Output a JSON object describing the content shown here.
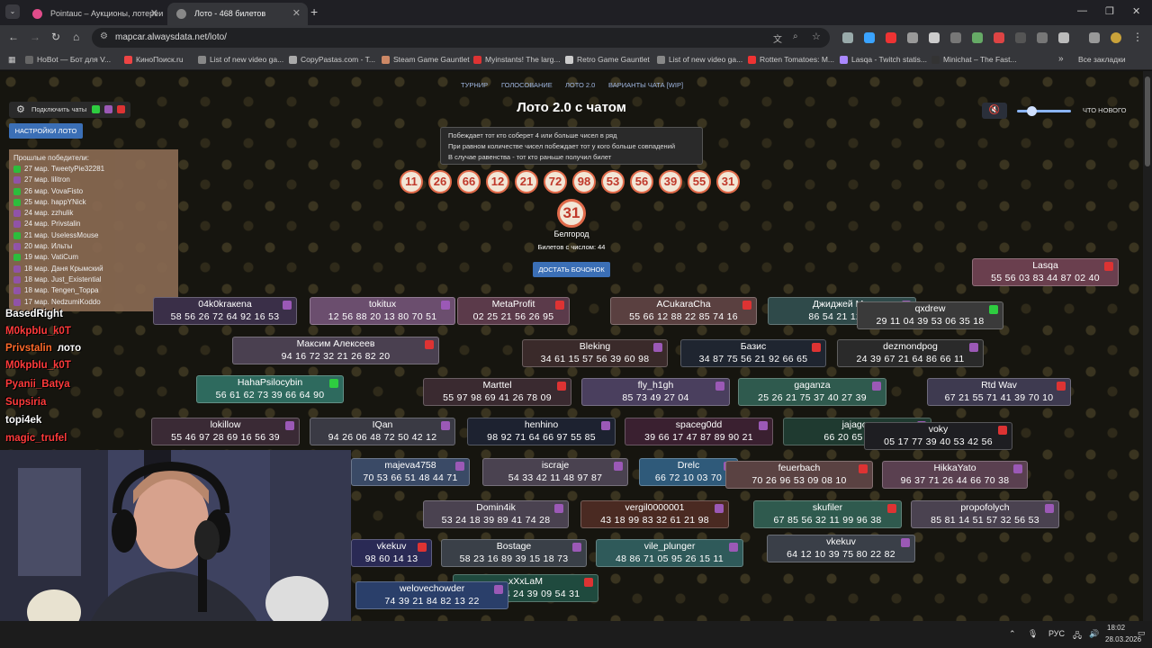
{
  "tabs": [
    {
      "label": "Pointauc – Аукционы, лотереи",
      "active": false,
      "color": "#e04c8a"
    },
    {
      "label": "Лото - 468 билетов",
      "active": true,
      "color": "#888"
    }
  ],
  "url": "mapcar.alwaysdata.net/loto/",
  "bookmarks": [
    {
      "label": "HoBot — Бот для V...",
      "color": "#666"
    },
    {
      "label": "КиноПоиск.ru",
      "color": "#e44"
    },
    {
      "label": "List of new video ga...",
      "color": "#888"
    },
    {
      "label": "CopyPastas.com - T...",
      "color": "#aaa"
    },
    {
      "label": "Steam Game Gauntlet",
      "color": "#c86"
    },
    {
      "label": "Myinstants! The larg...",
      "color": "#d33"
    },
    {
      "label": "Retro Game Gauntlet",
      "color": "#ccc"
    },
    {
      "label": "List of new video ga...",
      "color": "#888"
    },
    {
      "label": "Rotten Tomatoes: M...",
      "color": "#e33"
    },
    {
      "label": "Lasqa - Twitch statis...",
      "color": "#a8f"
    },
    {
      "label": "Minichat – The Fast...",
      "color": "#333"
    }
  ],
  "bookmarks_all": "Все закладки",
  "nav": [
    "ТУРНИР",
    "ГОЛОСОВАНИЕ",
    "ЛОТО 2.0",
    "ВАРИАНТЫ ЧАТА [WIP]"
  ],
  "title": "Лото 2.0 с чатом",
  "rules": [
    "Побеждает тот кто соберет 4 или больше чисел в ряд",
    "При равном количестве чисел побеждает тот у кого больше совпадений",
    "В случае равенства - тот кто раньше получил билет"
  ],
  "drawn": [
    "11",
    "26",
    "66",
    "12",
    "21",
    "72",
    "98",
    "53",
    "56",
    "39",
    "55",
    "31"
  ],
  "current": "31",
  "city": "Белгород",
  "tickets_count": "Билетов с числом: 44",
  "draw_button": "ДОСТАТЬ БОЧОНОК",
  "whats_new": "ЧТО НОВОГО",
  "connect_label": "Подключить чаты",
  "settings_label": "НАСТРОЙКИ ЛОТО",
  "winners_title": "Прошлые победители:",
  "winners": [
    {
      "text": "27 мар. TweetyPie32281",
      "c": "#2ecc40"
    },
    {
      "text": "27 мар. lilitron",
      "c": "#9b59b6"
    },
    {
      "text": "26 мар. VovaFisto",
      "c": "#2ecc40"
    },
    {
      "text": "25 мар. happYNick",
      "c": "#2ecc40"
    },
    {
      "text": "24 мар. zzhulik",
      "c": "#9b59b6"
    },
    {
      "text": "24 мар. Privstalin",
      "c": "#9b59b6"
    },
    {
      "text": "21 мар. UselessMouse",
      "c": "#2ecc40"
    },
    {
      "text": "20 мар. Ильты",
      "c": "#9b59b6"
    },
    {
      "text": "19 мар. VatiCum",
      "c": "#2ecc40"
    },
    {
      "text": "18 мар. Даня Крымский",
      "c": "#9b59b6"
    },
    {
      "text": "18 мар. Just_Existential",
      "c": "#9b59b6"
    },
    {
      "text": "18 мар. Tengen_Toppa",
      "c": "#9b59b6"
    },
    {
      "text": "17 мар. NedzumiKoddo",
      "c": "#9b59b6"
    }
  ],
  "tickets": [
    {
      "name": "Lasqa",
      "nums": "55 56 03 83 44 87 02 40",
      "bg": "#6a3f4e",
      "ic": "#d33"
    },
    {
      "name": "04k0kraкena",
      "nums": "58 56 26 72 64 92 16 53",
      "bg": "#3a2f48",
      "ic": "#9b59b6"
    },
    {
      "name": "tokitux",
      "nums": "12 56 88 20 13 80 70 51",
      "bg": "#6b4e6e",
      "ic": "#9b59b6"
    },
    {
      "name": "MetaProfit",
      "nums": "02 25 21 56 26 95",
      "bg": "#5b3a4a",
      "ic": "#d33"
    },
    {
      "name": "ACukaraCha",
      "nums": "55 66 12 88 22 85 74 16",
      "bg": "#5a4040",
      "ic": "#d33"
    },
    {
      "name": "Джиджей М...",
      "nums": "86 54 21 12 73",
      "bg": "#2f4a4a",
      "ic": "#9b59b6"
    },
    {
      "name": "qxdrew",
      "nums": "29 11 04 39 53 06 35 18",
      "bg": "#3a3a3a",
      "ic": "#2ecc40"
    },
    {
      "name": "Максим Алексеев",
      "nums": "94 16 72 32 21 26 82 20",
      "bg": "#4a4050",
      "ic": "#d33"
    },
    {
      "name": "Bleking",
      "nums": "34 61 15 57 56 39 60 98",
      "bg": "#3a2a2a",
      "ic": "#9b59b6"
    },
    {
      "name": "Базис",
      "nums": "34 87 75 56 21 92 66 65",
      "bg": "#1f2530",
      "ic": "#d33"
    },
    {
      "name": "dezmondpog",
      "nums": "24 39 67 21 64 86 66 11",
      "bg": "#2a2a2a",
      "ic": "#9b59b6"
    },
    {
      "name": "HahaPsilocybin",
      "nums": "56 61 62 73 39 66 64 90",
      "bg": "#2e6a5e",
      "ic": "#2ecc40"
    },
    {
      "name": "Marttel",
      "nums": "55 97 98 69 41 26 78 09",
      "bg": "#3a2a30",
      "ic": "#d33"
    },
    {
      "name": "fly_h1gh",
      "nums": "85 73 49 27 04",
      "bg": "#4a3f5e",
      "ic": "#9b59b6"
    },
    {
      "name": "gaganza",
      "nums": "25 26 21 75 37 40 27 39",
      "bg": "#2f5a4e",
      "ic": "#9b59b6"
    },
    {
      "name": "Rtd Wav",
      "nums": "67 21 55 71 41 39 70 10",
      "bg": "#3e3a50",
      "ic": "#d33"
    },
    {
      "name": "lokillow",
      "nums": "55 46 97 28 69 16 56 39",
      "bg": "#3a2a35",
      "ic": "#9b59b6"
    },
    {
      "name": "IQan",
      "nums": "94 26 06 48 72 50 42 12",
      "bg": "#3a3a44",
      "ic": "#9b59b6"
    },
    {
      "name": "henhino",
      "nums": "98 92 71 64 66 97 55 85",
      "bg": "#1d2230",
      "ic": "#9b59b6"
    },
    {
      "name": "spaceg0dd",
      "nums": "39 66 17 47 87 89 90 21",
      "bg": "#3a2030",
      "ic": "#9b59b6"
    },
    {
      "name": "jajagoo",
      "nums": "66 20 65 14 53",
      "bg": "#1f3a30",
      "ic": "#9b59b6"
    },
    {
      "name": "voky",
      "nums": "05 17 77 39 40 53 42 56",
      "bg": "#1e1e22",
      "ic": "#d33"
    },
    {
      "name": "majeva4758",
      "nums": "70 53 66 51 48 44 71",
      "bg": "#3a4a66",
      "ic": "#9b59b6"
    },
    {
      "name": "iscraje",
      "nums": "54 33 42 11 48 97 87",
      "bg": "#4a4250",
      "ic": "#9b59b6"
    },
    {
      "name": "Drelc",
      "nums": "66 72 10 03 70",
      "bg": "#2f5a7a",
      "ic": "#9b59b6"
    },
    {
      "name": "feuerbach",
      "nums": "70 26 96 53 09 08 10",
      "bg": "#5a4242",
      "ic": "#d33"
    },
    {
      "name": "HikkaYato",
      "nums": "96 37 71 26 44 66 70 38",
      "bg": "#5a4050",
      "ic": "#9b59b6"
    },
    {
      "name": "Domin4ik",
      "nums": "53 24 18 39 89 41 74 28",
      "bg": "#4a4250",
      "ic": "#9b59b6"
    },
    {
      "name": "vergil0000001",
      "nums": "43 18 99 83 32 61 21 98",
      "bg": "#4a2a22",
      "ic": "#9b59b6"
    },
    {
      "name": "skufiler",
      "nums": "67 85 56 32 11 99 96 38",
      "bg": "#2f5a4e",
      "ic": "#d33"
    },
    {
      "name": "propofolych",
      "nums": "85 81 14 51 57 32 56 53",
      "bg": "#4a4250",
      "ic": "#9b59b6"
    },
    {
      "name": "vkekuv",
      "nums": "98 60 14 13",
      "bg": "#2a2a55",
      "ic": "#d33"
    },
    {
      "name": "Bostage",
      "nums": "58 23 16 89 39 15 18 73",
      "bg": "#3a4048",
      "ic": "#9b59b6"
    },
    {
      "name": "vile_plunger",
      "nums": "48 86 71 05 95 26 15 11",
      "bg": "#2f5a5a",
      "ic": "#9b59b6"
    },
    {
      "name": "vkekuv",
      "nums": "64 12 10 39 75 80 22 82",
      "bg": "#3a3f48",
      "ic": "#9b59b6"
    },
    {
      "name": "xXxLaM",
      "nums": "71 68 94 24 39 09 54 31",
      "bg": "#1f4a3e",
      "ic": "#d33"
    },
    {
      "name": "welovechowder",
      "nums": "74 39 21 84 82 13 22",
      "bg": "#2a3f6a",
      "ic": "#9b59b6"
    }
  ],
  "chat": [
    {
      "name": "BasedRight",
      "text": "",
      "c": "#fff"
    },
    {
      "name": "M0kpbIu_k0T",
      "text": "",
      "c": "#ff3b3b"
    },
    {
      "name": "Privstalin",
      "text": "лото",
      "c": "#ff6a2a"
    },
    {
      "name": "M0kpbIu_k0T",
      "text": "",
      "c": "#ff3b3b"
    },
    {
      "name": "Pyanii_Batya",
      "text": "",
      "c": "#ff3b3b"
    },
    {
      "name": "Supsiria",
      "text": "",
      "c": "#ff3b3b"
    },
    {
      "name": "topi4ek",
      "text": "",
      "c": "#fff"
    },
    {
      "name": "magic_trufel",
      "text": "",
      "c": "#ff3b3b"
    }
  ],
  "taskbar": {
    "lang": "РУС",
    "time": "18:02",
    "date": "28.03.2026"
  }
}
